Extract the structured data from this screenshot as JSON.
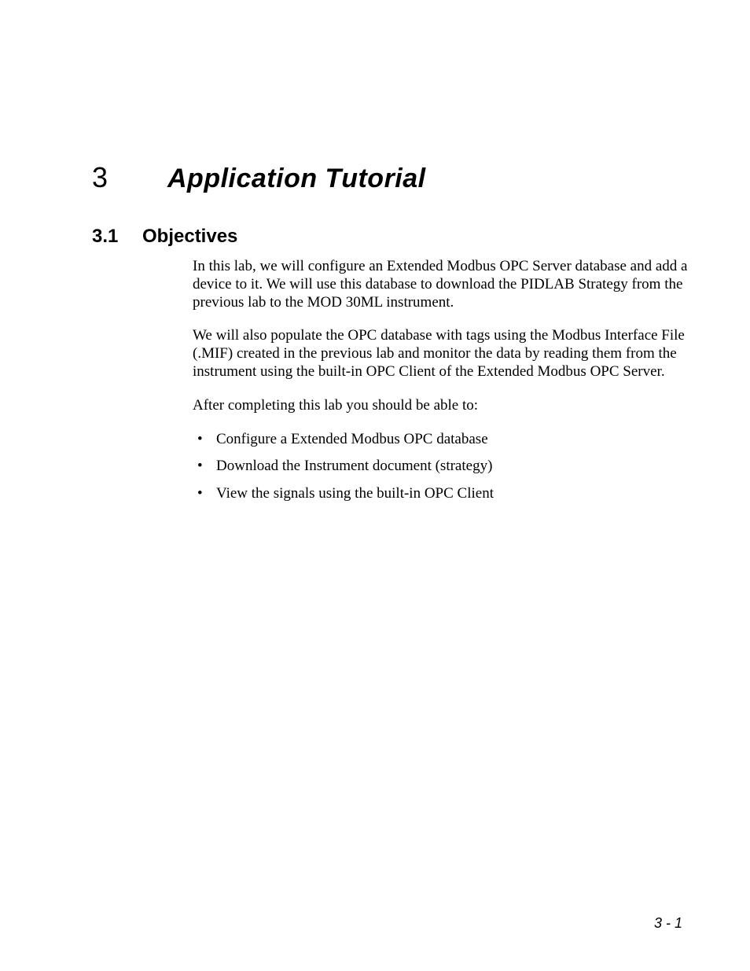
{
  "chapter": {
    "number": "3",
    "title": "Application Tutorial"
  },
  "section": {
    "number": "3.1",
    "title": "Objectives"
  },
  "paragraphs": {
    "p1": "In this lab, we will configure an Extended Modbus OPC Server database and add a device to it. We will use this database to download the PIDLAB Strategy from the previous lab to the MOD 30ML instrument.",
    "p2": "We will also populate the OPC database with tags using the Modbus Interface File (.MIF) created in the previous lab and monitor the data by reading them from the instrument using the built-in OPC Client of the Extended Modbus OPC Server.",
    "p3": "After completing this lab you should be able to:"
  },
  "objectives": [
    "Configure a Extended Modbus OPC database",
    "Download the Instrument document (strategy)",
    "View the signals using the built-in OPC Client"
  ],
  "page_number": "3 - 1"
}
